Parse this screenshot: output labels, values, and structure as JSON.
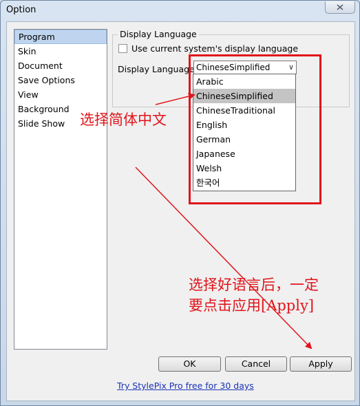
{
  "window": {
    "title": "Option"
  },
  "sidebar": {
    "items": [
      {
        "label": "Program",
        "selected": true
      },
      {
        "label": "Skin"
      },
      {
        "label": "Document"
      },
      {
        "label": "Save Options"
      },
      {
        "label": "View"
      },
      {
        "label": "Background"
      },
      {
        "label": "Slide Show"
      }
    ]
  },
  "display_language": {
    "group_title": "Display Language",
    "use_system_label": "Use current system's display language",
    "use_system_checked": false,
    "label": "Display Language",
    "selected": "ChineseSimplified",
    "options": [
      "Arabic",
      "ChineseSimplified",
      "ChineseTraditional",
      "English",
      "German",
      "Japanese",
      "Welsh",
      "한국어"
    ]
  },
  "annotations": {
    "select_chinese": "选择简体中文",
    "apply_line1": "选择好语言后，一定",
    "apply_line2": "要点击应用[Apply]",
    "color": "#e1141a"
  },
  "buttons": {
    "ok": "OK",
    "cancel": "Cancel",
    "apply": "Apply"
  },
  "footer": {
    "promo_link": "Try StylePix Pro free for 30 days"
  }
}
